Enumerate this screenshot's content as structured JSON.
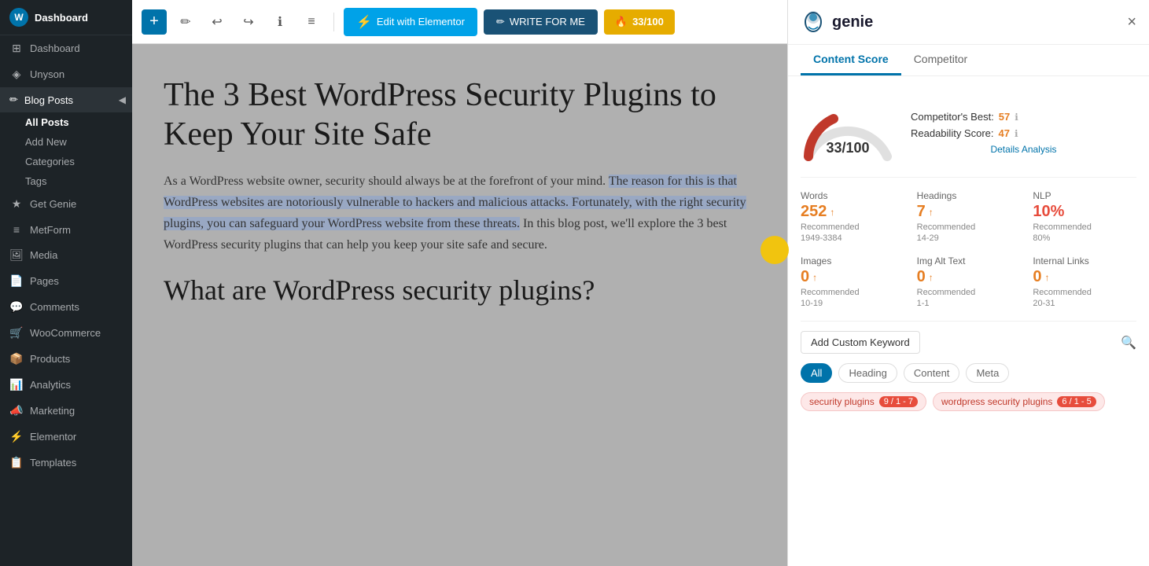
{
  "sidebar": {
    "site_name": "Dashboard",
    "items": [
      {
        "id": "dashboard",
        "label": "Dashboard",
        "icon": "⊞"
      },
      {
        "id": "unyson",
        "label": "Unyson",
        "icon": "◈"
      },
      {
        "id": "blog-posts",
        "label": "Blog Posts",
        "icon": "✏"
      },
      {
        "id": "get-genie",
        "label": "Get Genie",
        "icon": "★"
      },
      {
        "id": "metform",
        "label": "MetForm",
        "icon": "≡"
      },
      {
        "id": "media",
        "label": "Media",
        "icon": "🖼"
      },
      {
        "id": "pages",
        "label": "Pages",
        "icon": "📄"
      },
      {
        "id": "comments",
        "label": "Comments",
        "icon": "💬"
      },
      {
        "id": "woocommerce",
        "label": "WooCommerce",
        "icon": "🛒"
      },
      {
        "id": "products",
        "label": "Products",
        "icon": "📦"
      },
      {
        "id": "analytics",
        "label": "Analytics",
        "icon": "📊"
      },
      {
        "id": "marketing",
        "label": "Marketing",
        "icon": "📣"
      },
      {
        "id": "elementor",
        "label": "Elementor",
        "icon": "⚡"
      },
      {
        "id": "templates",
        "label": "Templates",
        "icon": "📋"
      }
    ],
    "blog_posts_sub": [
      {
        "id": "all-posts",
        "label": "All Posts",
        "active": true
      },
      {
        "id": "add-new",
        "label": "Add New"
      },
      {
        "id": "categories",
        "label": "Categories"
      },
      {
        "id": "tags",
        "label": "Tags"
      }
    ]
  },
  "toolbar": {
    "add_label": "+",
    "pencil_icon": "✏",
    "undo_icon": "↩",
    "redo_icon": "↪",
    "info_icon": "ℹ",
    "menu_icon": "≡",
    "edit_elementor_label": "Edit with Elementor",
    "write_for_me_label": "WRITE FOR ME",
    "score_label": "33/100"
  },
  "editor": {
    "title": "The 3 Best WordPress Security Plugins to Keep Your Site Safe",
    "body_plain": "As a WordPress website owner, security should always be at the forefront of your mind.",
    "body_highlighted": "The reason for this is that WordPress websites are notoriously vulnerable to hackers and malicious attacks. Fortunately, with the right security plugins, you can safeguard your WordPress website from these threats.",
    "body_end": "In this blog post, we'll explore the 3 best WordPress security plugins that can help you keep your site safe and secure.",
    "subtitle": "What are WordPress security plugins?"
  },
  "panel": {
    "logo_text": "genie",
    "close_icon": "×",
    "tabs": [
      {
        "id": "content-score",
        "label": "Content Score",
        "active": true
      },
      {
        "id": "competitor",
        "label": "Competitor",
        "active": false
      }
    ],
    "score": {
      "value": "33",
      "max": "100",
      "display": "33/100",
      "competitors_best_label": "Competitor's Best:",
      "competitors_best_value": "57",
      "readability_label": "Readability Score:",
      "readability_value": "47",
      "details_link": "Details Analysis"
    },
    "metrics": [
      {
        "id": "words",
        "label": "Words",
        "value": "252",
        "arrow": "↑",
        "rec_label": "Recommended",
        "rec_value": "1949-3384"
      },
      {
        "id": "headings",
        "label": "Headings",
        "value": "7",
        "arrow": "↑",
        "rec_label": "Recommended",
        "rec_value": "14-29"
      },
      {
        "id": "nlp",
        "label": "NLP",
        "value": "10%",
        "arrow": "",
        "rec_label": "Recommended",
        "rec_value": "80%",
        "color": "red"
      },
      {
        "id": "images",
        "label": "Images",
        "value": "0",
        "arrow": "↑",
        "rec_label": "Recommended",
        "rec_value": "10-19"
      },
      {
        "id": "img-alt-text",
        "label": "Img Alt Text",
        "value": "0",
        "arrow": "↑",
        "rec_label": "Recommended",
        "rec_value": "1-1"
      },
      {
        "id": "internal-links",
        "label": "Internal Links",
        "value": "0",
        "arrow": "↑",
        "rec_label": "Recommended",
        "rec_value": "20-31"
      }
    ],
    "add_keyword_label": "Add Custom Keyword",
    "filter_tabs": [
      {
        "id": "all",
        "label": "All",
        "active": true
      },
      {
        "id": "heading",
        "label": "Heading",
        "active": false
      },
      {
        "id": "content",
        "label": "Content",
        "active": false
      },
      {
        "id": "meta",
        "label": "Meta",
        "active": false
      }
    ],
    "keywords": [
      {
        "text": "security plugins",
        "counts": "9 / 1 - 7"
      },
      {
        "text": "wordpress security plugins",
        "counts": "6 / 1 - 5"
      }
    ]
  }
}
